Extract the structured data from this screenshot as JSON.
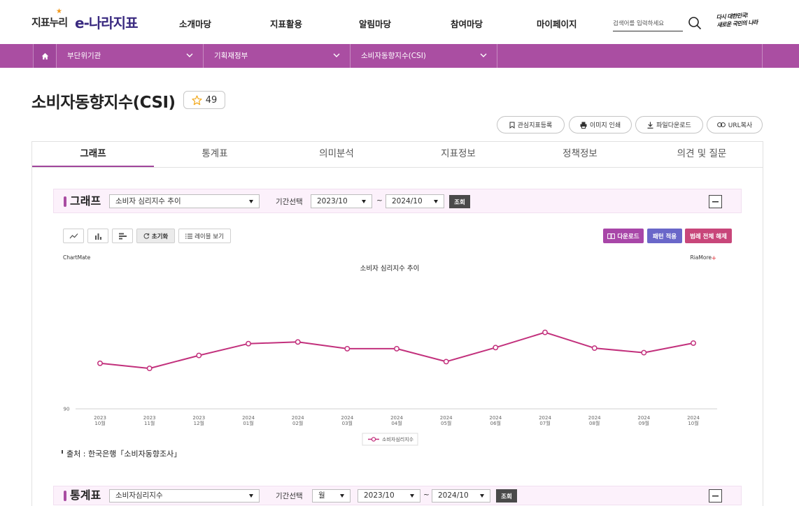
{
  "header": {
    "logo_sub": "지표누리",
    "logo_main": "e-나라지표",
    "nav": [
      "소개마당",
      "지표활용",
      "알림마당",
      "참여마당",
      "마이페이지"
    ],
    "search_placeholder": "검색어를 입력하세요",
    "slogan_line1": "다시 대한민국!",
    "slogan_line2": "새로운 국민의 나라"
  },
  "breadcrumb": {
    "items": [
      "부단위기관",
      "기획재정부",
      "소비자동향지수(CSI)"
    ]
  },
  "indicator": {
    "title": "소비자동향지수(CSI)",
    "favorite_count": "49",
    "actions": {
      "bookmark": "관심지표등록",
      "print": "이미지 인쇄",
      "download": "파일다운로드",
      "copy_url": "URL복사"
    }
  },
  "tabs": [
    "그래프",
    "통계표",
    "의미분석",
    "지표정보",
    "정책정보",
    "의견 및 질문"
  ],
  "active_tab_index": 0,
  "graph_section": {
    "heading": "그래프",
    "chart_select": "소비자 심리지수 추이",
    "period_label": "기간선택",
    "period_from": "2023/10",
    "tilde": "~",
    "period_to": "2024/10",
    "search_button": "조회"
  },
  "chart_toolbar": {
    "reset": "초기화",
    "label_view": "레이블 보기",
    "download": "다운로드",
    "pattern": "패턴 적용",
    "legend_clear": "범례 전체 해제"
  },
  "chart_watermarks": {
    "left": "ChartMate",
    "right": "RiaMore"
  },
  "chart_data": {
    "type": "line",
    "title": "소비자 심리지수 추이",
    "categories": [
      [
        "2023",
        "10월"
      ],
      [
        "2023",
        "11월"
      ],
      [
        "2023",
        "12월"
      ],
      [
        "2024",
        "01월"
      ],
      [
        "2024",
        "02월"
      ],
      [
        "2024",
        "03월"
      ],
      [
        "2024",
        "04월"
      ],
      [
        "2024",
        "05월"
      ],
      [
        "2024",
        "06월"
      ],
      [
        "2024",
        "07월"
      ],
      [
        "2024",
        "08월"
      ],
      [
        "2024",
        "09월"
      ],
      [
        "2024",
        "10월"
      ]
    ],
    "series": [
      {
        "name": "소비자심리지수",
        "color": "#c2307c",
        "values": [
          98.1,
          97.2,
          99.5,
          101.6,
          101.9,
          100.7,
          100.7,
          98.4,
          100.9,
          103.6,
          100.8,
          100.0,
          101.7
        ]
      }
    ],
    "y_ticks": [
      90
    ],
    "ylim": [
      90,
      113
    ],
    "grid": false,
    "legend_position": "bottom"
  },
  "source_note": "출처 : 한국은행「소비자동향조사」",
  "table_section": {
    "heading": "통계표",
    "item_select": "소비자심리지수",
    "period_label": "기간선택",
    "period_unit": "월",
    "period_from": "2023/10",
    "tilde": "~",
    "period_to": "2024/10",
    "search_button": "조회"
  },
  "icons": {
    "home": "home-icon",
    "chevron": "chevron-down-icon",
    "search": "search-icon",
    "favorite": "star-icon",
    "bookmark": "bookmark-icon",
    "print": "printer-icon",
    "download": "download-icon",
    "link": "link-icon",
    "line_chart": "line-chart-icon",
    "bar_chart": "bar-chart-icon",
    "hbar_chart": "horizontal-bar-chart-icon",
    "refresh": "refresh-icon",
    "list": "list-icon",
    "collapse": "minus-icon"
  },
  "colors": {
    "brand": "#aa4ea2",
    "logo": "#3a2a80",
    "series": "#c2307c",
    "download_button": "#a846a8",
    "pattern_button": "#6a67c9",
    "legend_clear_button": "#c8467a"
  }
}
